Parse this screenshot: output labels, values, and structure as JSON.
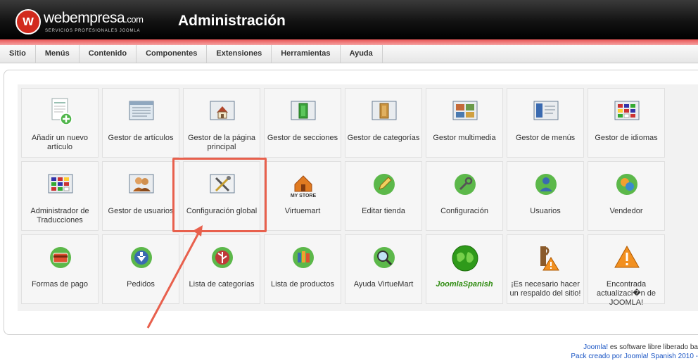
{
  "header": {
    "logo_mark": "w",
    "logo_name": "webempresa",
    "logo_suffix": ".com",
    "logo_tagline": "SERVICIOS PROFESIONALES JOOMLA",
    "title": "Administración"
  },
  "menu": [
    {
      "label": "Sitio"
    },
    {
      "label": "Menús"
    },
    {
      "label": "Contenido"
    },
    {
      "label": "Componentes"
    },
    {
      "label": "Extensiones"
    },
    {
      "label": "Herramientas"
    },
    {
      "label": "Ayuda"
    }
  ],
  "tiles": [
    {
      "label": "Añadir un nuevo artículo",
      "icon": "add-article-icon"
    },
    {
      "label": "Gestor de artículos",
      "icon": "article-manager-icon"
    },
    {
      "label": "Gestor de la página principal",
      "icon": "home-icon"
    },
    {
      "label": "Gestor de secciones",
      "icon": "sections-icon"
    },
    {
      "label": "Gestor de categorías",
      "icon": "categories-icon"
    },
    {
      "label": "Gestor multimedia",
      "icon": "media-icon"
    },
    {
      "label": "Gestor de menús",
      "icon": "menu-manager-icon"
    },
    {
      "label": "Gestor de idiomas",
      "icon": "languages-icon"
    },
    {
      "label": "Administrador de Traducciones",
      "icon": "translations-icon"
    },
    {
      "label": "Gestor de usuarios",
      "icon": "users-icon"
    },
    {
      "label": "Configuración global",
      "icon": "tools-icon"
    },
    {
      "label": "Virtuemart",
      "icon": "mystore-icon",
      "icon_text": "MY STORE"
    },
    {
      "label": "Editar tienda",
      "icon": "edit-pencil-icon"
    },
    {
      "label": "Configuración",
      "icon": "wrench-icon"
    },
    {
      "label": "Usuarios",
      "icon": "user-icon"
    },
    {
      "label": "Vendedor",
      "icon": "vendor-icon"
    },
    {
      "label": "Formas de pago",
      "icon": "payment-icon"
    },
    {
      "label": "Pedidos",
      "icon": "orders-down-arrow-icon"
    },
    {
      "label": "Lista de categorías",
      "icon": "category-tree-icon"
    },
    {
      "label": "Lista de productos",
      "icon": "product-list-icon"
    },
    {
      "label": "Ayuda VirtueMart",
      "icon": "help-magnifier-icon"
    },
    {
      "label": "JoomlaSpanish",
      "icon": "globe-icon"
    },
    {
      "label": "¡Es necesario hacer un respaldo del sitio!",
      "icon": "backup-warning-icon"
    },
    {
      "label": "Encontrada actualizaci�n de JOOMLA!",
      "icon": "warning-icon"
    }
  ],
  "footer": {
    "line1_link": "Joomla!",
    "line1_text": " es software libre liberado ba",
    "line2": "Pack creado por Joomla! Spanish 2010 -"
  },
  "colors": {
    "header_bg": "#0b0b0b",
    "accent_red": "#e85454",
    "highlight": "#e8604d",
    "link": "#1a55c4",
    "joomlaspanish_green": "#2e8b0f"
  }
}
